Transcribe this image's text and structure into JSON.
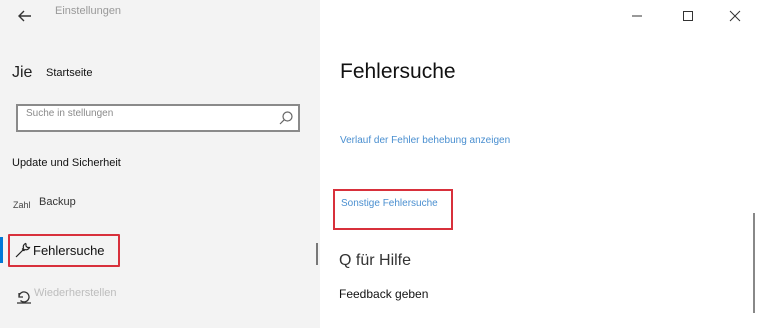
{
  "window": {
    "title": "Einstellungen"
  },
  "sidebar": {
    "home_glyph": "Jie",
    "home_label": "Startseite",
    "search_placeholder": "Suche in stellungen",
    "section_title": "Update und Sicherheit",
    "items": [
      {
        "icon_text": "Zahl",
        "label": "Backup"
      },
      {
        "label": "Fehlersuche",
        "icon": "wrench-icon",
        "selected": true
      },
      {
        "label": "Wiederherstellen",
        "icon": "restore-icon"
      }
    ]
  },
  "main": {
    "title": "Fehlersuche",
    "history_link": "Verlauf der Fehler behebung anzeigen",
    "other_link": "Sonstige Fehlersuche",
    "help_title": "Q für Hilfe",
    "feedback_link": "Feedback geben"
  },
  "colors": {
    "accent": "#0078d7",
    "link": "#4a8fd0",
    "highlight": "#d8303b"
  }
}
